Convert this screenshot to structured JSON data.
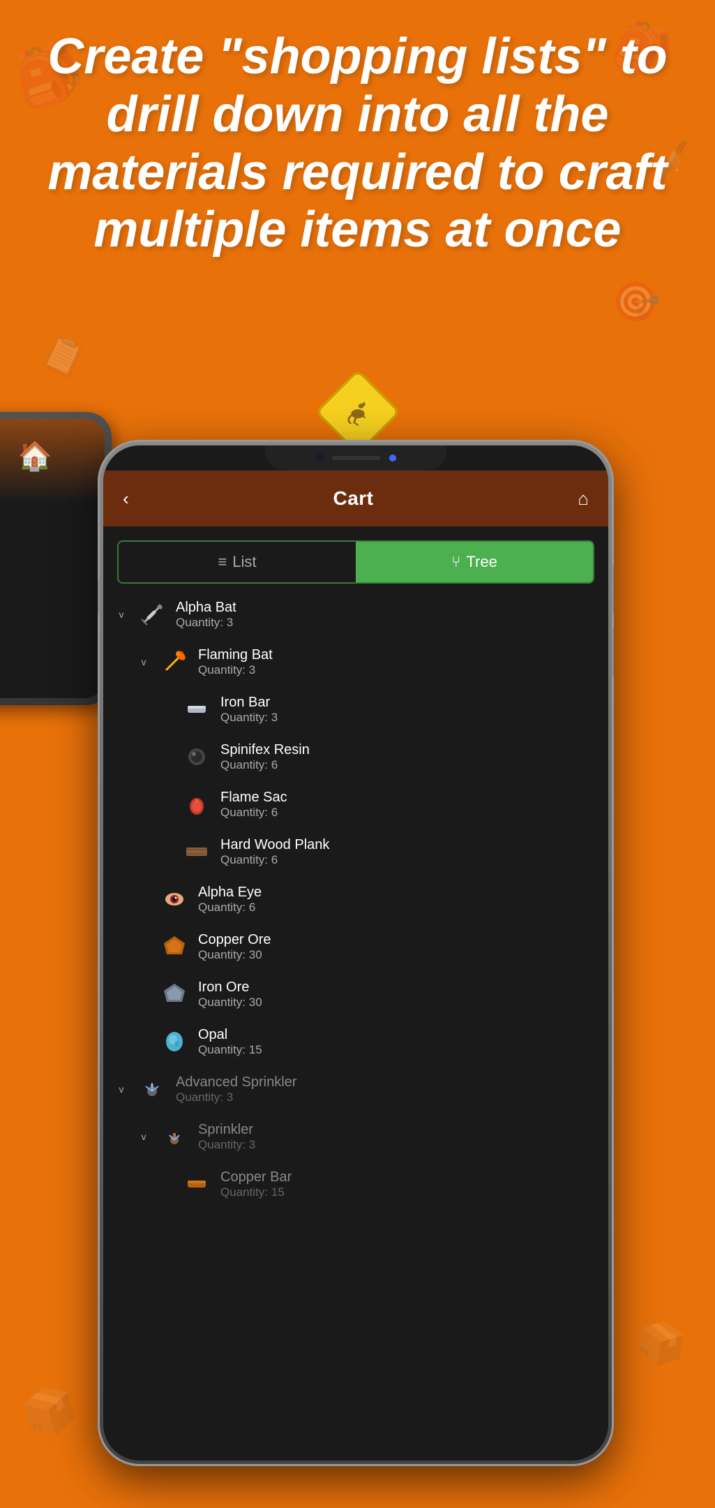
{
  "background_color": "#E8710A",
  "headline": {
    "text": "Create \"shopping lists\" to drill down into all the materials required to craft multiple items at once"
  },
  "kangaroo_sign": {
    "alt": "Kangaroo warning sign logo"
  },
  "app": {
    "header": {
      "title": "Cart",
      "back_label": "‹",
      "home_label": "⌂"
    },
    "tabs": [
      {
        "label": "List",
        "icon": "≡",
        "active": false
      },
      {
        "label": "Tree",
        "icon": "⑂",
        "active": true
      }
    ],
    "items": [
      {
        "id": 1,
        "name": "Alpha Bat",
        "quantity": "Quantity: 3",
        "indent": 0,
        "has_chevron": true,
        "icon": "sword",
        "muted": false
      },
      {
        "id": 2,
        "name": "Flaming Bat",
        "quantity": "Quantity: 3",
        "indent": 1,
        "has_chevron": true,
        "icon": "flaming-bat",
        "muted": false
      },
      {
        "id": 3,
        "name": "Iron Bar",
        "quantity": "Quantity: 3",
        "indent": 2,
        "has_chevron": false,
        "icon": "iron-bar",
        "muted": false
      },
      {
        "id": 4,
        "name": "Spinifex Resin",
        "quantity": "Quantity: 6",
        "indent": 2,
        "has_chevron": false,
        "icon": "resin",
        "muted": false
      },
      {
        "id": 5,
        "name": "Flame Sac",
        "quantity": "Quantity: 6",
        "indent": 2,
        "has_chevron": false,
        "icon": "flame-sac",
        "muted": false
      },
      {
        "id": 6,
        "name": "Hard Wood Plank",
        "quantity": "Quantity: 6",
        "indent": 2,
        "has_chevron": false,
        "icon": "wood-plank",
        "muted": false
      },
      {
        "id": 7,
        "name": "Alpha Eye",
        "quantity": "Quantity: 6",
        "indent": 1,
        "has_chevron": false,
        "icon": "alpha-eye",
        "muted": false
      },
      {
        "id": 8,
        "name": "Copper Ore",
        "quantity": "Quantity: 30",
        "indent": 1,
        "has_chevron": false,
        "icon": "copper-ore",
        "muted": false
      },
      {
        "id": 9,
        "name": "Iron Ore",
        "quantity": "Quantity: 30",
        "indent": 1,
        "has_chevron": false,
        "icon": "iron-ore",
        "muted": false
      },
      {
        "id": 10,
        "name": "Opal",
        "quantity": "Quantity: 15",
        "indent": 1,
        "has_chevron": false,
        "icon": "opal",
        "muted": false
      },
      {
        "id": 11,
        "name": "Advanced Sprinkler",
        "quantity": "Quantity: 3",
        "indent": 0,
        "has_chevron": true,
        "icon": "advanced-sprinkler",
        "muted": true
      },
      {
        "id": 12,
        "name": "Sprinkler",
        "quantity": "Quantity: 3",
        "indent": 1,
        "has_chevron": true,
        "icon": "sprinkler",
        "muted": true
      },
      {
        "id": 13,
        "name": "Copper Bar",
        "quantity": "Quantity: 15",
        "indent": 2,
        "has_chevron": false,
        "icon": "copper-bar",
        "muted": true
      }
    ]
  }
}
